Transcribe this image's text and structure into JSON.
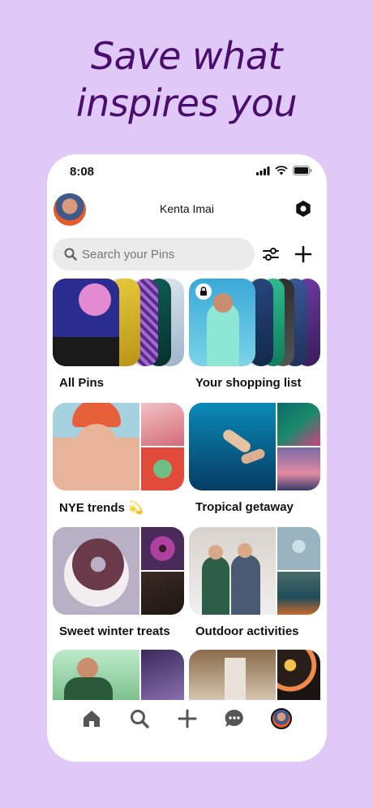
{
  "headline": {
    "line1": "Save what",
    "line2": "inspires you"
  },
  "status_bar": {
    "time": "8:08"
  },
  "profile": {
    "name": "Kenta Imai"
  },
  "search": {
    "placeholder": "Search your Pins"
  },
  "boards": [
    {
      "title": "All Pins"
    },
    {
      "title": "Your shopping list"
    },
    {
      "title": "NYE trends 💫"
    },
    {
      "title": "Tropical getaway"
    },
    {
      "title": "Sweet winter treats"
    },
    {
      "title": "Outdoor activities"
    }
  ],
  "icons": {
    "settings": "hexagon-settings-icon",
    "filter": "sliders-icon",
    "add": "plus-icon",
    "nav": [
      "home-icon",
      "search-icon",
      "plus-icon",
      "chat-icon",
      "profile-avatar"
    ]
  },
  "colors": {
    "background": "#e0c8f7",
    "headline": "#4a0d6e"
  }
}
